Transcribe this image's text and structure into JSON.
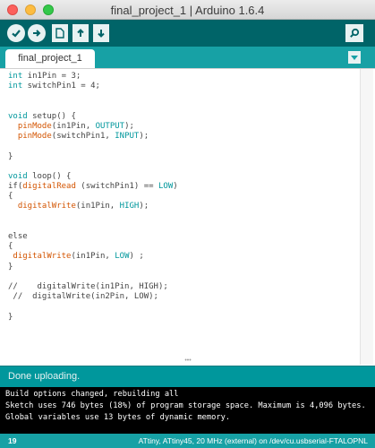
{
  "window": {
    "title": "final_project_1 | Arduino 1.6.4"
  },
  "toolbar": {
    "buttons": [
      {
        "name": "verify",
        "icon": "checkmark-icon"
      },
      {
        "name": "upload",
        "icon": "arrow-right-icon"
      },
      {
        "name": "new",
        "icon": "new-file-icon"
      },
      {
        "name": "open",
        "icon": "arrow-up-icon"
      },
      {
        "name": "save",
        "icon": "arrow-down-icon"
      },
      {
        "name": "serial-monitor",
        "icon": "magnifier-icon"
      }
    ]
  },
  "tabs": [
    {
      "label": "final_project_1",
      "active": true
    }
  ],
  "editor": {
    "lines": [
      "int in1Pin = 3;",
      "int switchPin1 = 4;",
      "",
      "",
      "void setup() {",
      "  pinMode(in1Pin, OUTPUT);",
      "  pinMode(switchPin1, INPUT);",
      "",
      "}",
      "",
      "void loop() {",
      "if(digitalRead (switchPin1) == LOW)",
      "{",
      "  digitalWrite(in1Pin, HIGH);",
      "",
      "",
      "else",
      "{",
      " digitalWrite(in1Pin, LOW) ;",
      "}",
      "",
      "//    digitalWrite(in1Pin, HIGH);",
      " //  digitalWrite(in2Pin, LOW);",
      "",
      "}"
    ]
  },
  "status": {
    "message": "Done uploading."
  },
  "console": {
    "lines": [
      "Build options changed, rebuilding all",
      "Sketch uses 746 bytes (18%) of program storage space. Maximum is 4,096 bytes.",
      "Global variables use 13 bytes of dynamic memory."
    ]
  },
  "footer": {
    "line_number": "19",
    "board_info": "ATtiny, ATtiny45, 20 MHz (external) on /dev/cu.usbserial-FTALOPNL"
  },
  "colors": {
    "teal_dark": "#006468",
    "teal": "#17a1a5",
    "status": "#00979c",
    "keyword": "#00979c",
    "function": "#d35400"
  }
}
